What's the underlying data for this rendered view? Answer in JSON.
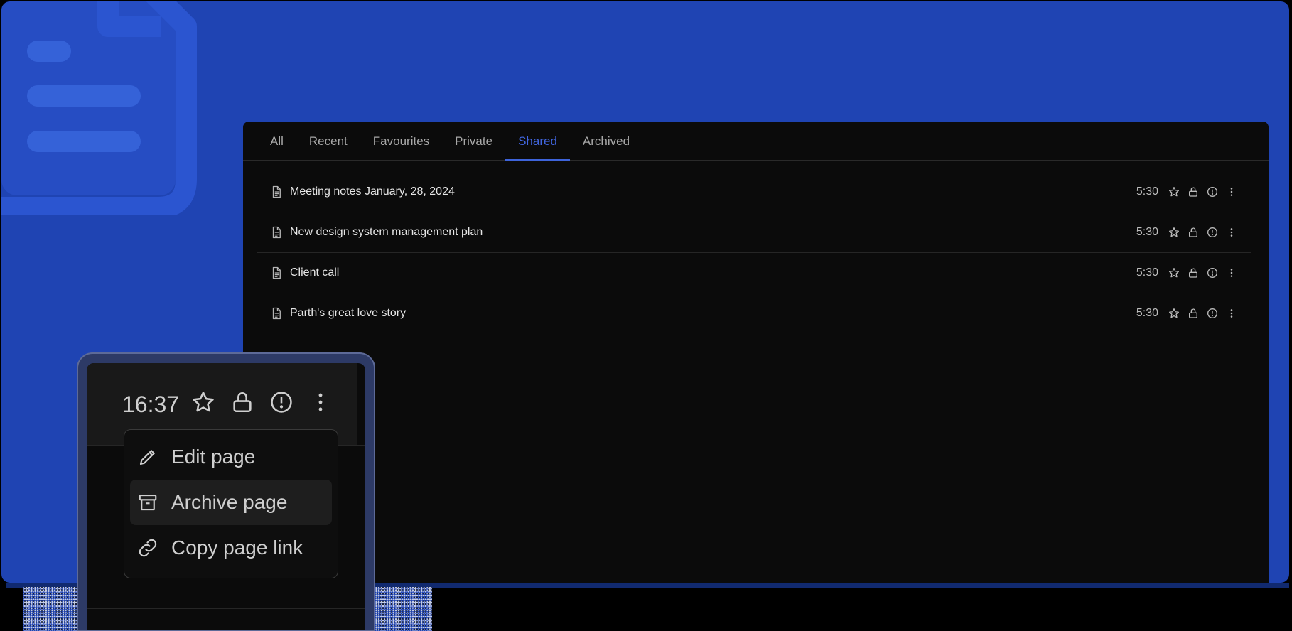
{
  "tabs": [
    {
      "label": "All"
    },
    {
      "label": "Recent"
    },
    {
      "label": "Favourites"
    },
    {
      "label": "Private"
    },
    {
      "label": "Shared"
    },
    {
      "label": "Archived"
    }
  ],
  "active_tab": "Shared",
  "pages": [
    {
      "title": "Meeting notes January, 28, 2024",
      "time": "5:30"
    },
    {
      "title": "New design system management plan",
      "time": "5:30"
    },
    {
      "title": "Client call",
      "time": "5:30"
    },
    {
      "title": "Parth's great love story",
      "time": "5:30"
    }
  ],
  "zoom": {
    "time": "16:37"
  },
  "menu": {
    "items": [
      {
        "label": "Edit page",
        "icon": "pencil-icon"
      },
      {
        "label": "Archive page",
        "icon": "archive-icon"
      },
      {
        "label": "Copy page link",
        "icon": "link-icon"
      }
    ]
  },
  "colors": {
    "background": "#1f44b3",
    "panel": "#0b0b0b",
    "accent": "#4166e0"
  }
}
